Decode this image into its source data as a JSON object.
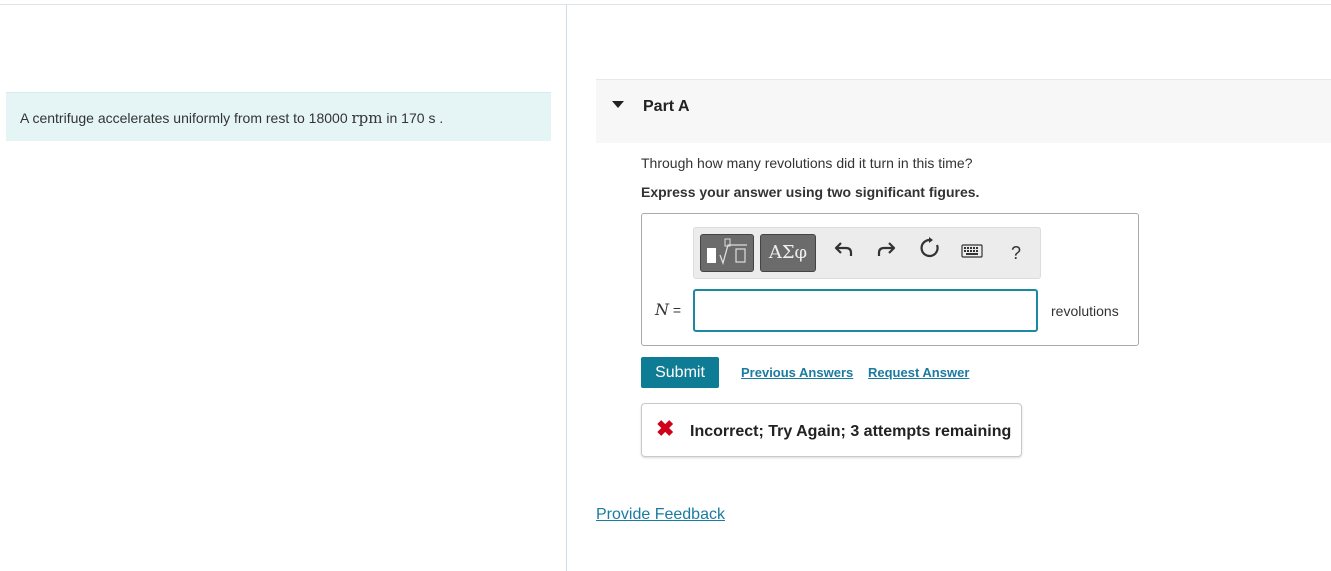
{
  "problem": {
    "text_before": "A centrifuge accelerates uniformly from rest to 18000 ",
    "unit_rpm": "rpm",
    "text_middle": " in 170 ",
    "unit_s": "s",
    "text_after": " ."
  },
  "part": {
    "title": "Part A",
    "question": "Through how many revolutions did it turn in this time?",
    "instruction": "Express your answer using two significant figures."
  },
  "toolbar": {
    "greek_label": "ΑΣφ",
    "undo_icon": "undo-icon",
    "redo_icon": "redo-icon",
    "reset_icon": "reset-icon",
    "keyboard_icon": "keyboard-icon",
    "help_label": "?"
  },
  "answer": {
    "variable": "N",
    "equals": " =",
    "value": "",
    "unit": "revolutions"
  },
  "actions": {
    "submit_label": "Submit",
    "previous_answers_label": "Previous Answers",
    "request_answer_label": "Request Answer"
  },
  "feedback": {
    "message": "Incorrect; Try Again; 3 attempts remaining",
    "icon": "x-icon",
    "color": "#d0021b"
  },
  "footer": {
    "provide_feedback_label": "Provide Feedback"
  },
  "colors": {
    "accent": "#0e7c94",
    "link": "#1a7ba0",
    "intro_bg": "#e5f5f6"
  }
}
